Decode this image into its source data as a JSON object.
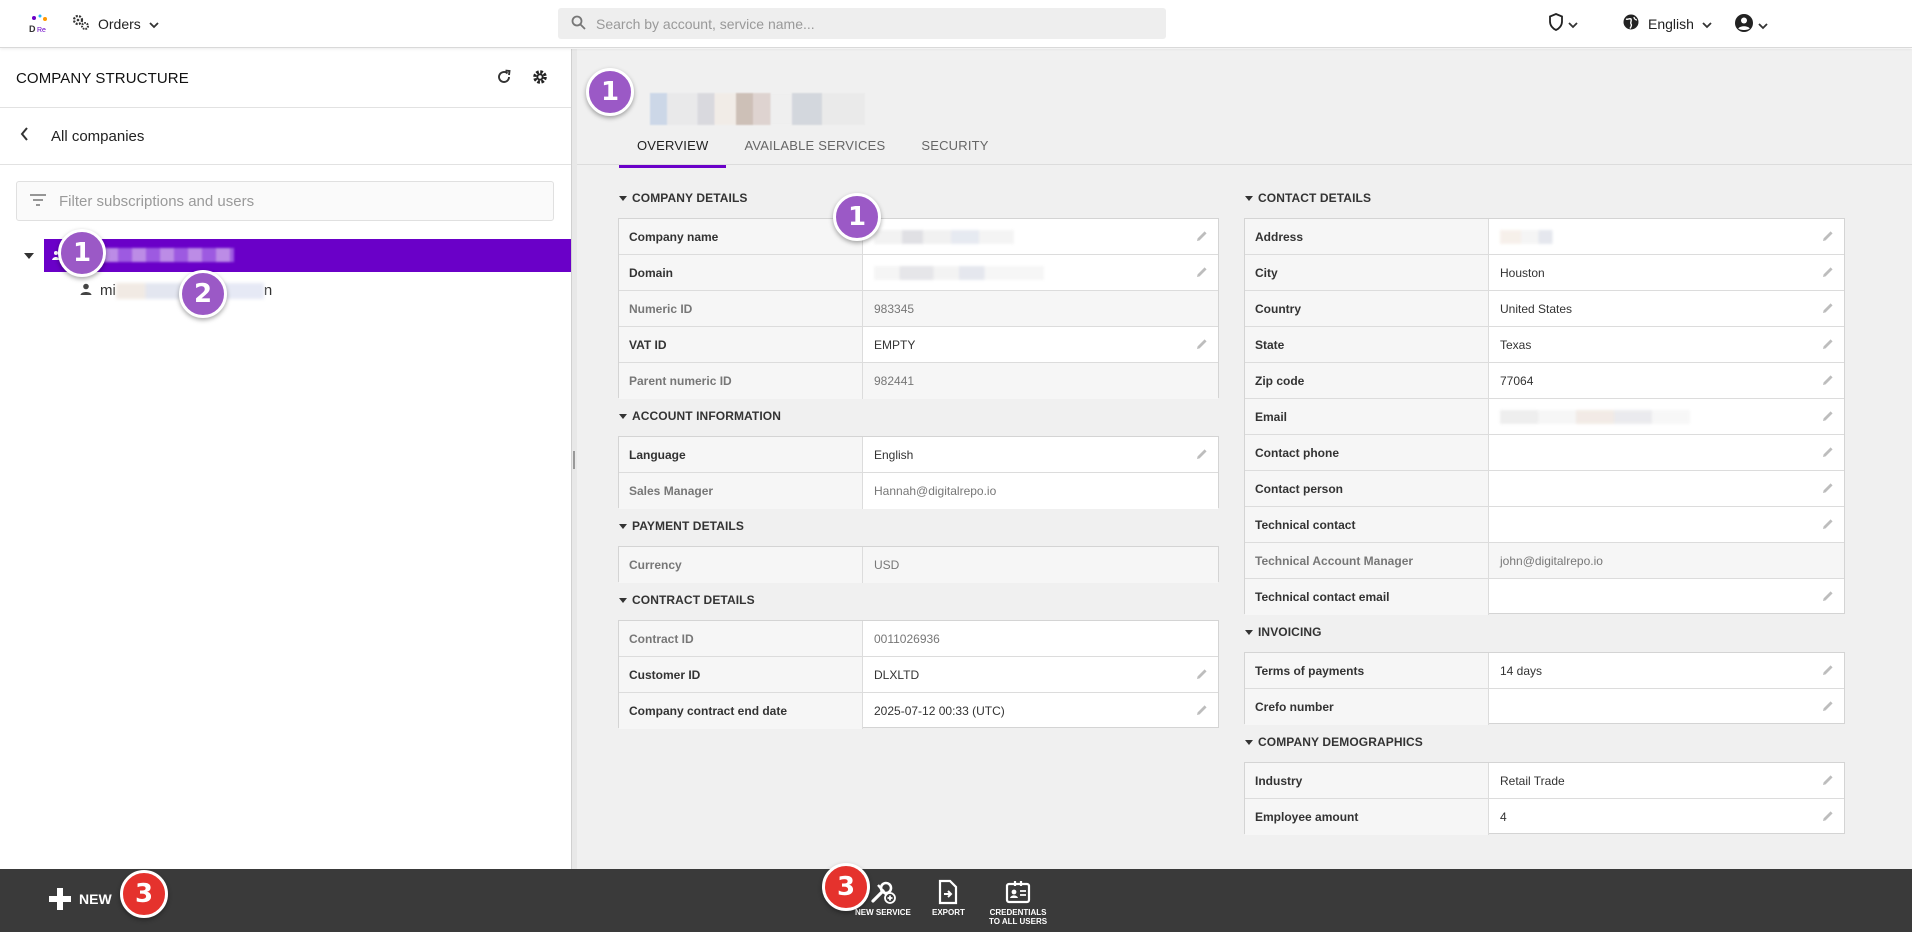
{
  "topbar": {
    "nav_label": "Orders",
    "search_placeholder": "Search by account, service name...",
    "language": "English"
  },
  "left": {
    "title": "COMPANY STRUCTURE",
    "back_label": "All companies",
    "filter_placeholder": "Filter subscriptions and users",
    "user_prefix": "mi",
    "user_suffix": "n"
  },
  "tabs": [
    "OVERVIEW",
    "AVAILABLE SERVICES",
    "SECURITY"
  ],
  "sections": {
    "company_details": {
      "title": "COMPANY DETAILS",
      "rows": [
        {
          "label": "Company name",
          "value": ""
        },
        {
          "label": "Domain",
          "value": ""
        },
        {
          "label": "Numeric ID",
          "value": "983345"
        },
        {
          "label": "VAT ID",
          "value": "EMPTY"
        },
        {
          "label": "Parent numeric ID",
          "value": "982441"
        }
      ]
    },
    "account_information": {
      "title": "ACCOUNT INFORMATION",
      "rows": [
        {
          "label": "Language",
          "value": "English"
        },
        {
          "label": "Sales Manager",
          "value": "Hannah@digitalrepo.io"
        }
      ]
    },
    "payment_details": {
      "title": "PAYMENT DETAILS",
      "rows": [
        {
          "label": "Currency",
          "value": "USD"
        }
      ]
    },
    "contract_details": {
      "title": "CONTRACT DETAILS",
      "rows": [
        {
          "label": "Contract ID",
          "value": "0011026936"
        },
        {
          "label": "Customer ID",
          "value": "DLXLTD"
        },
        {
          "label": "Company contract end date",
          "value": "2025-07-12 00:33 (UTC)"
        }
      ]
    },
    "contact_details": {
      "title": "CONTACT DETAILS",
      "rows": [
        {
          "label": "Address",
          "value": ""
        },
        {
          "label": "City",
          "value": "Houston"
        },
        {
          "label": "Country",
          "value": "United States"
        },
        {
          "label": "State",
          "value": "Texas"
        },
        {
          "label": "Zip code",
          "value": "77064"
        },
        {
          "label": "Email",
          "value": ""
        },
        {
          "label": "Contact phone",
          "value": ""
        },
        {
          "label": "Contact person",
          "value": ""
        },
        {
          "label": "Technical contact",
          "value": ""
        },
        {
          "label": "Technical Account Manager",
          "value": "john@digitalrepo.io"
        },
        {
          "label": "Technical contact email",
          "value": ""
        }
      ]
    },
    "invoicing": {
      "title": "INVOICING",
      "rows": [
        {
          "label": "Terms of payments",
          "value": "14 days"
        },
        {
          "label": "Crefo number",
          "value": ""
        }
      ]
    },
    "company_demographics": {
      "title": "COMPANY DEMOGRAPHICS",
      "rows": [
        {
          "label": "Industry",
          "value": "Retail Trade"
        },
        {
          "label": "Employee amount",
          "value": "4"
        }
      ]
    }
  },
  "bottombar": {
    "new_label": "NEW",
    "new_service_label": "NEW SERVICE",
    "export_label": "EXPORT",
    "credentials_line1": "CREDENTIALS",
    "credentials_line2": "TO ALL USERS"
  },
  "badges": {
    "one": "1",
    "two": "2",
    "three": "3"
  },
  "colors": {
    "accent": "#6a00c8",
    "badge_purple": "#9b59c6",
    "badge_red": "#e5322d",
    "bottombar": "#3a3a3a"
  }
}
